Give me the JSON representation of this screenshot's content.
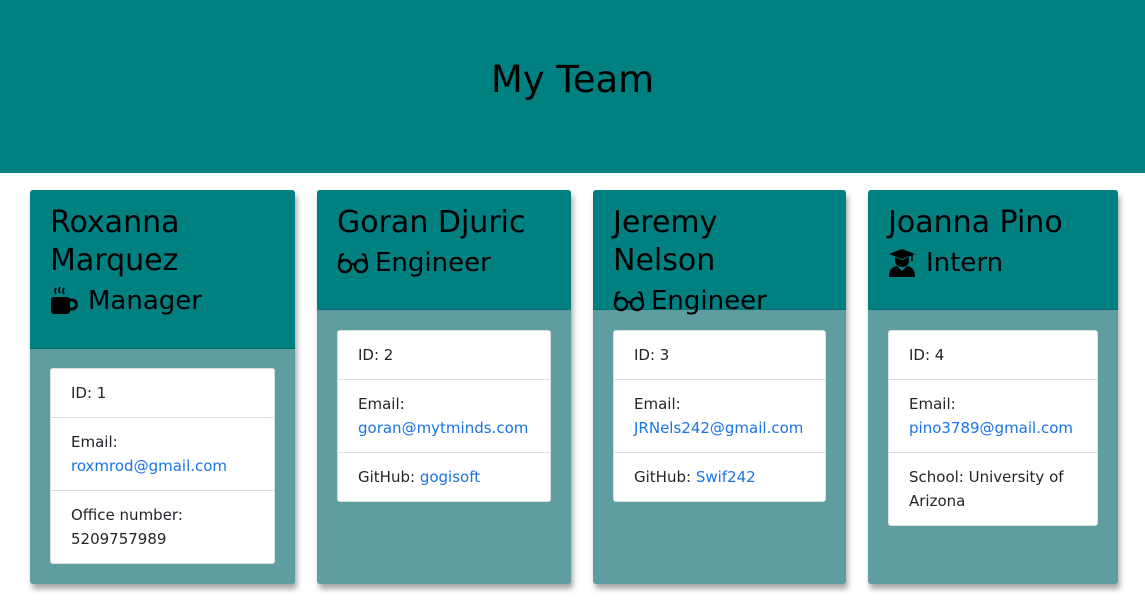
{
  "header": {
    "title": "My Team"
  },
  "employees": [
    {
      "name": "Roxanna Marquez",
      "role": "Manager",
      "icon": "mug-icon",
      "id_label": "ID: 1",
      "email_label": "Email:",
      "email": "roxmrod@gmail.com",
      "extra_label": "Office number:",
      "extra_value": "5209757989"
    },
    {
      "name": "Goran Djuric",
      "role": "Engineer",
      "icon": "glasses-icon",
      "id_label": "ID: 2",
      "email_label": "Email:",
      "email": "goran@mytminds.com",
      "extra_label": "GitHub:",
      "extra_value": "gogisoft"
    },
    {
      "name": "Jeremy Nelson",
      "role": "Engineer",
      "icon": "glasses-icon",
      "id_label": "ID: 3",
      "email_label": "Email:",
      "email": "JRNels242@gmail.com",
      "extra_label": "GitHub:",
      "extra_value": "Swif242"
    },
    {
      "name": "Joanna Pino",
      "role": "Intern",
      "icon": "graduate-icon",
      "id_label": "ID: 4",
      "email_label": "Email:",
      "email": "pino3789@gmail.com",
      "extra_label": "School:",
      "extra_value": "University of Arizona"
    }
  ],
  "colors": {
    "header_bg": "#008080",
    "card_body_bg": "#5f9ea0",
    "link": "#1a73e8"
  }
}
